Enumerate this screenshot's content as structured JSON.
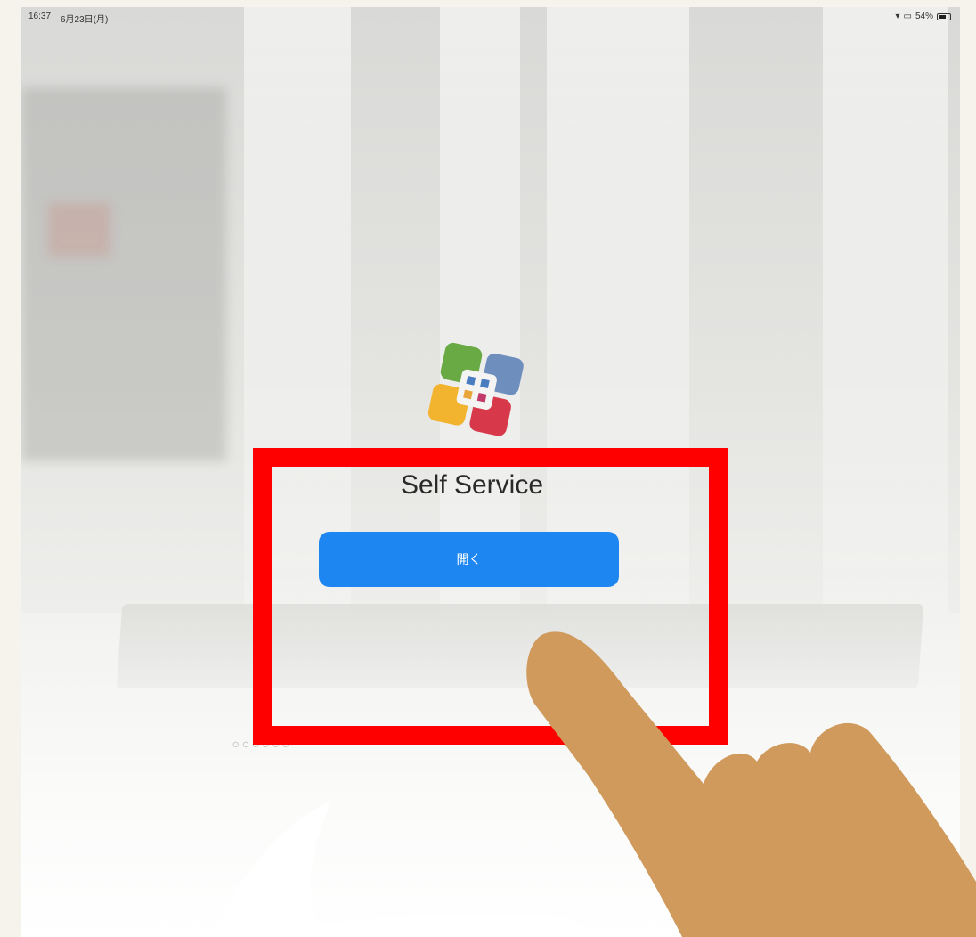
{
  "status_bar": {
    "time": "16:37",
    "date": "6月23日(月)",
    "battery_percent": "54%"
  },
  "app": {
    "title": "Self Service",
    "open_button_label": "開く",
    "icon_name": "self-service-app-icon"
  },
  "annotation": {
    "highlight_color": "#ff0000",
    "hand_color": "#cf9a5c",
    "speech_bubble_color": "#ffffff"
  },
  "colors": {
    "button_blue": "#1e86f0"
  }
}
